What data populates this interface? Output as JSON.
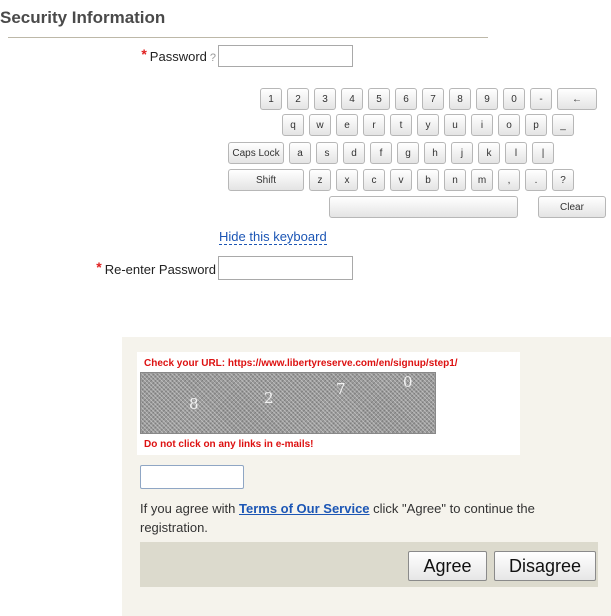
{
  "section": {
    "title": "Security Information"
  },
  "password": {
    "required_mark": "*",
    "label": "Password",
    "help": "?",
    "value": ""
  },
  "keyboard": {
    "row1": [
      "1",
      "2",
      "3",
      "4",
      "5",
      "6",
      "7",
      "8",
      "9",
      "0",
      "-",
      "←"
    ],
    "row2": [
      "q",
      "w",
      "e",
      "r",
      "t",
      "y",
      "u",
      "i",
      "o",
      "p",
      "_"
    ],
    "row3": [
      "Caps Lock",
      "a",
      "s",
      "d",
      "f",
      "g",
      "h",
      "j",
      "k",
      "l",
      "|"
    ],
    "row4": [
      "Shift",
      "z",
      "x",
      "c",
      "v",
      "b",
      "n",
      "m",
      ",",
      ".",
      "?"
    ],
    "space_label": "",
    "clear_label": "Clear",
    "hide_label": "Hide this keyboard"
  },
  "reenter": {
    "required_mark": "*",
    "label": "Re-enter Password",
    "value": ""
  },
  "captcha": {
    "url_notice": "Check your URL: https://www.libertyreserve.com/en/signup/step1/",
    "characters": [
      "8",
      "2",
      "7",
      "0"
    ],
    "warning": "Do not click on any links in e-mails!",
    "input_value": ""
  },
  "terms": {
    "before": "If you agree with ",
    "link": "Terms of Our Service",
    "after": " click \"Agree\" to continue the registration."
  },
  "buttons": {
    "agree": "Agree",
    "disagree": "Disagree"
  }
}
